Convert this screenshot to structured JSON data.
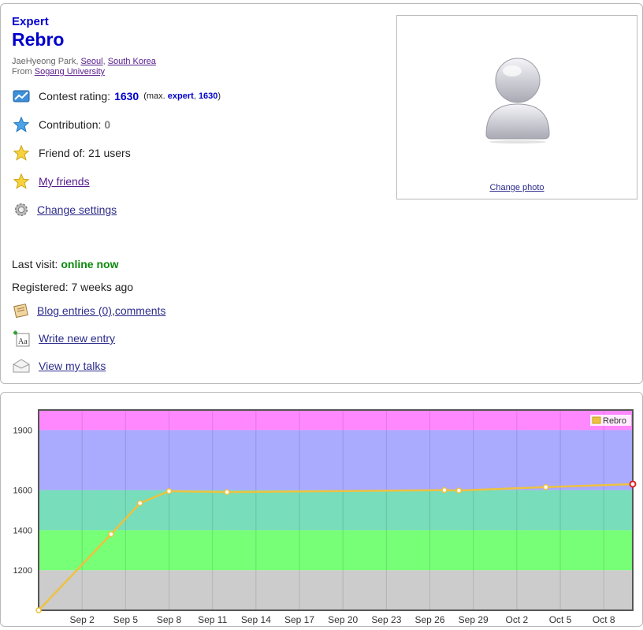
{
  "profile": {
    "rank": "Expert",
    "handle": "Rebro",
    "name_prefix": "JaeHyeong Park, ",
    "city": "Seoul",
    "comma": ", ",
    "country": "South Korea",
    "from_label": "From ",
    "organization": "Sogang University"
  },
  "stats": {
    "rating_label": "Contest rating: ",
    "rating_value": "1630",
    "rating_max_prefix": "(max. ",
    "rating_max_rank": "expert",
    "rating_max_sep": ", ",
    "rating_max_value": "1630",
    "rating_max_suffix": ")",
    "contribution_label": "Contribution: ",
    "contribution_value": "0",
    "friend_of": "Friend of: 21 users",
    "my_friends": "My friends",
    "change_settings": "Change settings"
  },
  "activity": {
    "last_visit_label": "Last visit: ",
    "last_visit_value": "online now",
    "registered": "Registered: 7 weeks ago",
    "blog_entries": "Blog entries (0)",
    "blog_sep": ", ",
    "comments": "comments",
    "write_entry": "Write new entry",
    "view_talks": "View my talks"
  },
  "photo": {
    "change_photo": "Change photo"
  },
  "colors": {
    "link": "#2b2b8b",
    "rank_blue": "#0000cc",
    "online_green": "#0a8a0a",
    "line": "#edc240",
    "band_gray": "#cccccc",
    "band_green": "#77ff77",
    "band_cyan": "#77ddbb",
    "band_blue": "#aaaaff",
    "band_violet": "#ff88ff"
  },
  "chart_data": {
    "type": "line",
    "series": [
      {
        "name": "Rebro",
        "x": [
          "Aug 30",
          "Sep 4",
          "Sep 6",
          "Sep 8",
          "Sep 12",
          "Sep 27",
          "Sep 28",
          "Oct 4",
          "Oct 10"
        ],
        "y": [
          1000,
          1380,
          1535,
          1595,
          1590,
          1600,
          1598,
          1615,
          1630
        ]
      }
    ],
    "x_ticks": [
      "Sep 2",
      "Sep 5",
      "Sep 8",
      "Sep 11",
      "Sep 14",
      "Sep 17",
      "Sep 20",
      "Sep 23",
      "Sep 26",
      "Sep 29",
      "Oct 2",
      "Oct 5",
      "Oct 8"
    ],
    "y_ticks": [
      "1200",
      "1400",
      "1600",
      "1900"
    ],
    "ylim": [
      1000,
      2000
    ],
    "bands": [
      {
        "from": 1000,
        "to": 1200,
        "color": "#cccccc"
      },
      {
        "from": 1200,
        "to": 1400,
        "color": "#77ff77"
      },
      {
        "from": 1400,
        "to": 1600,
        "color": "#77ddbb"
      },
      {
        "from": 1600,
        "to": 1900,
        "color": "#aaaaff"
      },
      {
        "from": 1900,
        "to": 2000,
        "color": "#ff88ff"
      }
    ],
    "grid": true,
    "legend": "top-right"
  }
}
